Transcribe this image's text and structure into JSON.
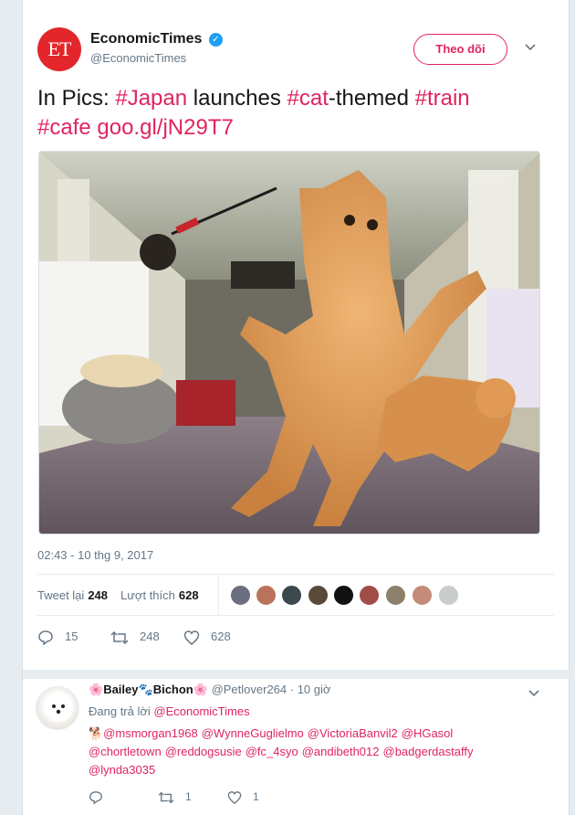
{
  "author": {
    "logo_text": "ET",
    "name": "EconomicTimes",
    "handle": "@EconomicTimes",
    "verified_icon": "✓",
    "follow_label": "Theo dõi"
  },
  "tweet": {
    "parts": [
      {
        "text": "In Pics: ",
        "type": "text"
      },
      {
        "text": "#Japan",
        "type": "hashtag"
      },
      {
        "text": " launches ",
        "type": "text"
      },
      {
        "text": "#cat",
        "type": "hashtag"
      },
      {
        "text": "-themed ",
        "type": "text"
      },
      {
        "text": "#train",
        "type": "hashtag"
      },
      {
        "text": "#cafe",
        "type": "hashtag"
      },
      {
        "text": " ",
        "type": "text"
      },
      {
        "text": "goo.gl/jN29T7",
        "type": "link"
      }
    ],
    "timestamp": "02:43 - 10 thg 9, 2017"
  },
  "stats": {
    "retweets_label": "Tweet lại",
    "retweets": "248",
    "likes_label": "Lượt thích",
    "likes": "628"
  },
  "actions": {
    "reply_count": "15",
    "retweet_count": "248",
    "like_count": "628"
  },
  "reply": {
    "name_prefix_emoji": "🌸",
    "name": "Bailey",
    "paw": "🐾",
    "name2": "Bichon",
    "name_suffix_emoji": "🌸",
    "handle": "@Petlover264",
    "time": "· 10 giờ",
    "replying_prefix": "Đang trả lời",
    "replying_to": "@EconomicTimes",
    "mentions": [
      "🐕@msmorgan1968",
      "@WynneGuglielmo",
      "@VictoriaBanvil2",
      "@HGasol",
      "@chortletown",
      "@reddogsusie",
      "@fc_4syo",
      "@andibeth012",
      "@badgerdastaffy",
      "@lynda3035"
    ],
    "reply_count": "",
    "retweet_count": "1",
    "like_count": "1"
  },
  "colors": {
    "accent": "#e0245e",
    "brand_red": "#e3262c",
    "verified": "#1da1f2",
    "muted": "#657786"
  }
}
